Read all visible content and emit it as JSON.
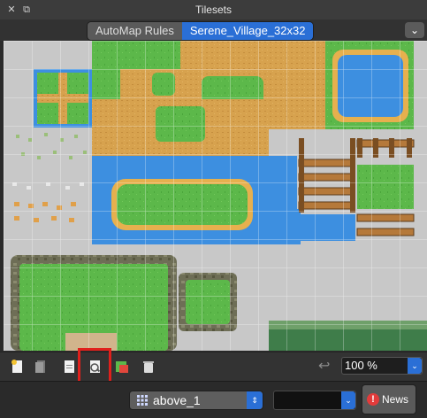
{
  "window": {
    "title": "Tilesets",
    "close_glyph": "✕",
    "float_glyph": "⧉"
  },
  "tabs": [
    {
      "label": "AutoMap Rules",
      "active": false
    },
    {
      "label": "Serene_Village_32x32",
      "active": true
    }
  ],
  "tab_menu_glyph": "⌄",
  "toolbar": {
    "icons": [
      "new-tileset-icon",
      "embed-tileset-icon",
      "export-tileset-icon",
      "edit-tileset-icon",
      "edit-terrain-icon",
      "delete-tileset-icon"
    ],
    "undo_glyph": "↩",
    "zoom_value": "100 %",
    "dropdown_glyph": "⌄"
  },
  "status": {
    "layer_value": "above_1",
    "stepper_glyph": "⇕",
    "news_badge": "!",
    "news_label": "News"
  },
  "colors": {
    "accent": "#2a6fd6",
    "grass": "#5cb84a",
    "water": "#3d8fe0",
    "dirt": "#d7a24e",
    "highlight": "#e0201c"
  }
}
